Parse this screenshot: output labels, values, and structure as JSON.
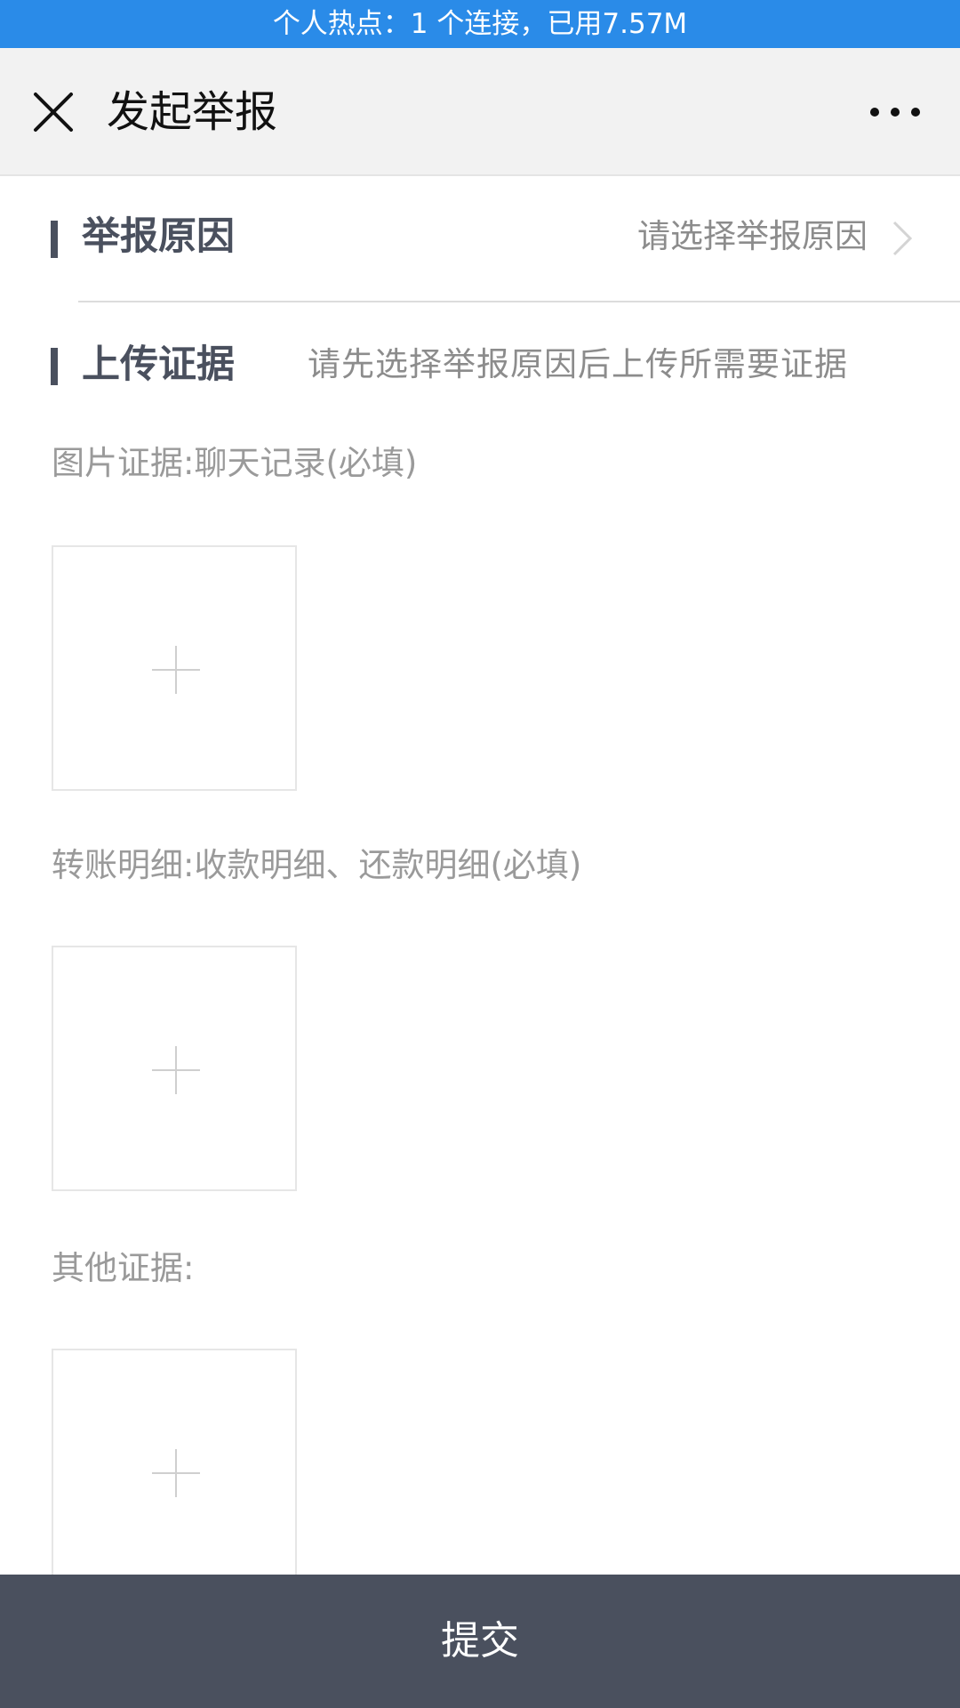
{
  "status_bar": {
    "text": "个人热点：1 个连接，已用7.57M"
  },
  "header": {
    "title": "发起举报",
    "close_icon": "close-icon",
    "more_icon": "more-horizontal-icon"
  },
  "report_reason": {
    "title": "举报原因",
    "value": "请选择举报原因",
    "chevron_icon": "chevron-right-icon"
  },
  "upload_evidence": {
    "title": "上传证据",
    "hint": "请先选择举报原因后上传所需要证据",
    "sections": [
      {
        "label": "图片证据:聊天记录(必填)",
        "add_icon": "plus-icon"
      },
      {
        "label": "转账明细:收款明细、还款明细(必填)",
        "add_icon": "plus-icon"
      },
      {
        "label": "其他证据:",
        "add_icon": "plus-icon"
      }
    ]
  },
  "submit": {
    "label": "提交"
  },
  "colors": {
    "status_bar": "#2a8be8",
    "header_bg": "#f2f2f2",
    "section_title": "#4a505e",
    "hint_text": "#8c8c8c",
    "submit_bg": "#4a505e"
  }
}
